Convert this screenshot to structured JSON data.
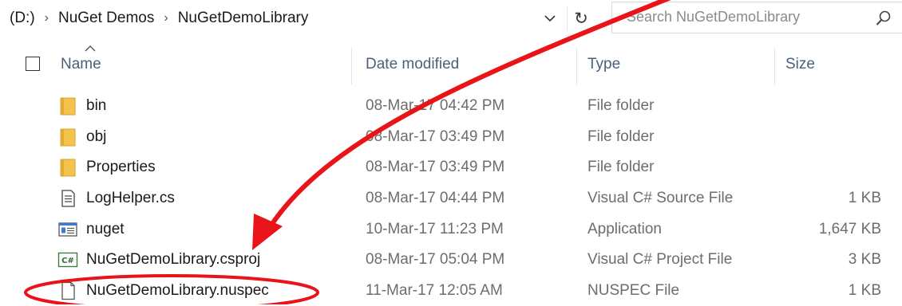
{
  "address": {
    "crumbs": [
      "(D:)",
      "NuGet Demos",
      "NuGetDemoLibrary"
    ],
    "separator": "›",
    "refresh_glyph": "↻"
  },
  "search": {
    "placeholder": "Search NuGetDemoLibrary",
    "icon": "search-icon"
  },
  "columns": {
    "name": "Name",
    "date": "Date modified",
    "type": "Type",
    "size": "Size",
    "sort_indicator": "chevron-up-icon"
  },
  "files": [
    {
      "name": "bin",
      "date": "08-Mar-17 04:42 PM",
      "type": "File folder",
      "size": "",
      "icon": "folder-icon"
    },
    {
      "name": "obj",
      "date": "08-Mar-17 03:49 PM",
      "type": "File folder",
      "size": "",
      "icon": "folder-icon"
    },
    {
      "name": "Properties",
      "date": "08-Mar-17 03:49 PM",
      "type": "File folder",
      "size": "",
      "icon": "folder-icon"
    },
    {
      "name": "LogHelper.cs",
      "date": "08-Mar-17 04:44 PM",
      "type": "Visual C# Source File",
      "size": "1 KB",
      "icon": "text-document-icon"
    },
    {
      "name": "nuget",
      "date": "10-Mar-17 11:23 PM",
      "type": "Application",
      "size": "1,647 KB",
      "icon": "application-icon"
    },
    {
      "name": "NuGetDemoLibrary.csproj",
      "date": "08-Mar-17 05:04 PM",
      "type": "Visual C# Project File",
      "size": "3 KB",
      "icon": "csharp-project-icon",
      "badge": "C#"
    },
    {
      "name": "NuGetDemoLibrary.nuspec",
      "date": "11-Mar-17 12:05 AM",
      "type": "NUSPEC File",
      "size": "1 KB",
      "icon": "blank-document-icon"
    }
  ],
  "colors": {
    "annotation": "#e8141a",
    "folder": "#f4c24d",
    "header_text": "#4c607a"
  }
}
